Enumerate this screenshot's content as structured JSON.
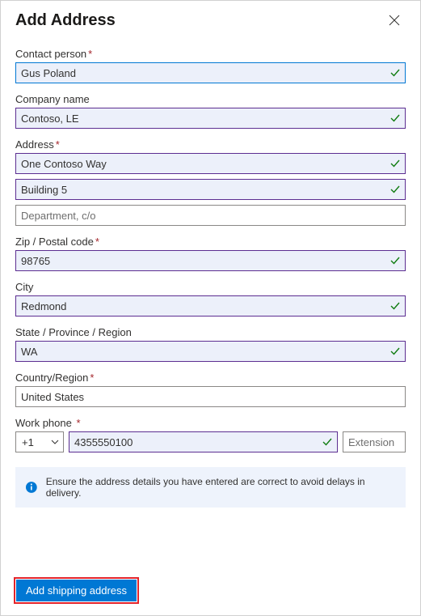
{
  "title": "Add Address",
  "fields": {
    "contact": {
      "label": "Contact person",
      "required": true,
      "value": "Gus Poland"
    },
    "company": {
      "label": "Company name",
      "required": false,
      "value": "Contoso, LE"
    },
    "address": {
      "label": "Address",
      "required": true,
      "line1": "One Contoso Way",
      "line2": "Building 5",
      "line3": "",
      "line3_placeholder": "Department, c/o"
    },
    "zip": {
      "label": "Zip / Postal code",
      "required": true,
      "value": "98765"
    },
    "city": {
      "label": "City",
      "required": false,
      "value": "Redmond"
    },
    "state": {
      "label": "State / Province / Region",
      "required": false,
      "value": "WA"
    },
    "country": {
      "label": "Country/Region",
      "required": true,
      "value": "United States"
    },
    "phone": {
      "label": "Work phone",
      "required": true,
      "country_code": "+1",
      "number": "4355550100",
      "ext_placeholder": "Extension"
    }
  },
  "info_message": "Ensure the address details you have entered are correct to avoid delays in delivery.",
  "submit_label": "Add shipping address"
}
